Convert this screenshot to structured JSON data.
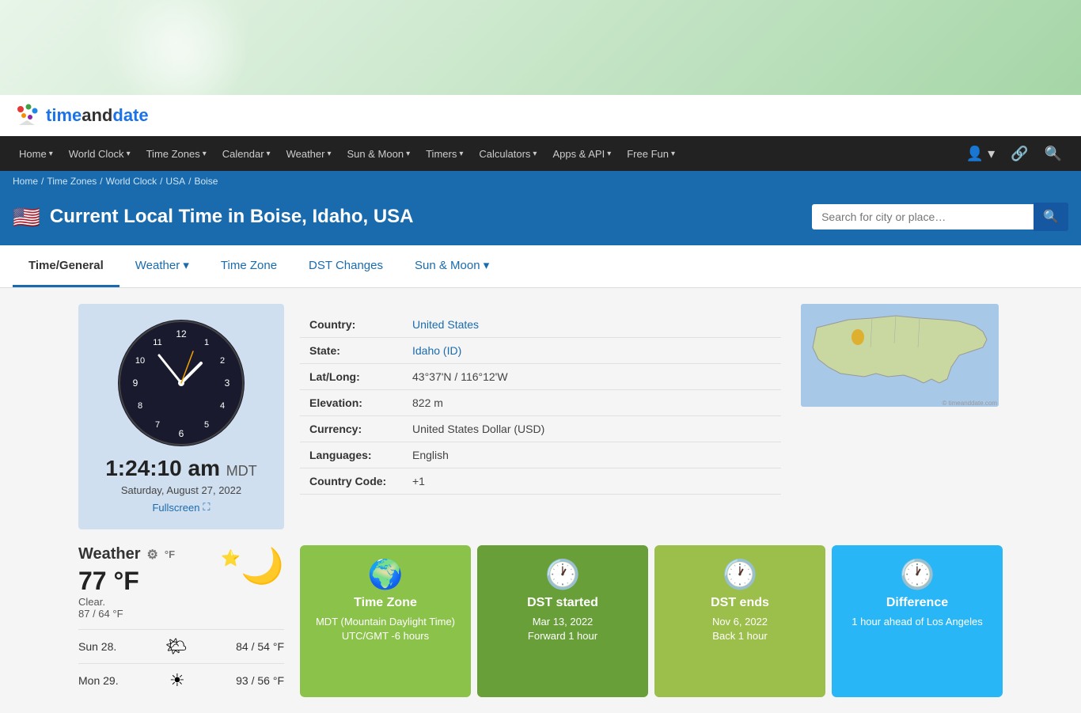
{
  "logo": {
    "text_before": "time",
    "text_bold": "and",
    "text_after": "date"
  },
  "nav": {
    "items": [
      {
        "label": "Home",
        "has_arrow": true
      },
      {
        "label": "World Clock",
        "has_arrow": true
      },
      {
        "label": "Time Zones",
        "has_arrow": true
      },
      {
        "label": "Calendar",
        "has_arrow": true
      },
      {
        "label": "Weather",
        "has_arrow": true
      },
      {
        "label": "Sun & Moon",
        "has_arrow": true
      },
      {
        "label": "Timers",
        "has_arrow": true
      },
      {
        "label": "Calculators",
        "has_arrow": true
      },
      {
        "label": "Apps & API",
        "has_arrow": true
      },
      {
        "label": "Free Fun",
        "has_arrow": true
      }
    ]
  },
  "breadcrumb": {
    "items": [
      "Home",
      "Time Zones",
      "World Clock",
      "USA",
      "Boise"
    ]
  },
  "page_header": {
    "title": "Current Local Time in Boise, Idaho, USA",
    "search_placeholder": "Search for city or place…"
  },
  "tabs": [
    {
      "label": "Time/General",
      "active": true
    },
    {
      "label": "Weather",
      "has_arrow": true
    },
    {
      "label": "Time Zone"
    },
    {
      "label": "DST Changes"
    },
    {
      "label": "Sun & Moon",
      "has_arrow": true
    }
  ],
  "clock": {
    "time": "1:24:10 am",
    "timezone": "MDT",
    "date": "Saturday, August 27, 2022",
    "fullscreen_label": "Fullscreen"
  },
  "info": {
    "rows": [
      {
        "label": "Country:",
        "value": "United States",
        "link": true
      },
      {
        "label": "State:",
        "value": "Idaho (ID)",
        "link": true
      },
      {
        "label": "Lat/Long:",
        "value": "43°37'N / 116°12'W"
      },
      {
        "label": "Elevation:",
        "value": "822 m"
      },
      {
        "label": "Currency:",
        "value": "United States Dollar (USD)"
      },
      {
        "label": "Languages:",
        "value": "English"
      },
      {
        "label": "Country Code:",
        "value": "+1"
      }
    ]
  },
  "weather": {
    "title": "Weather",
    "temp": "77 °F",
    "desc": "Clear.",
    "range": "87 / 64 °F",
    "unit": "°F",
    "icon": "🌙",
    "star": "⭐",
    "forecast": [
      {
        "day": "Sun 28.",
        "icon": "🌤",
        "range": "84 / 54 °F"
      },
      {
        "day": "Mon 29.",
        "icon": "☀",
        "range": "93 / 56 °F"
      }
    ]
  },
  "cards": [
    {
      "color": "green",
      "title": "Time Zone",
      "value": "MDT (Mountain Daylight Time)\nUTC/GMT -6 hours",
      "icon": "🌍"
    },
    {
      "color": "dark-green",
      "title": "DST started",
      "value": "Mar 13, 2022\nForward 1 hour",
      "icon": "🕐"
    },
    {
      "color": "olive",
      "title": "DST ends",
      "value": "Nov 6, 2022\nBack 1 hour",
      "icon": "🕐"
    },
    {
      "color": "blue",
      "title": "Difference",
      "value": "1 hour ahead of Los Angeles",
      "icon": "🕐"
    }
  ]
}
